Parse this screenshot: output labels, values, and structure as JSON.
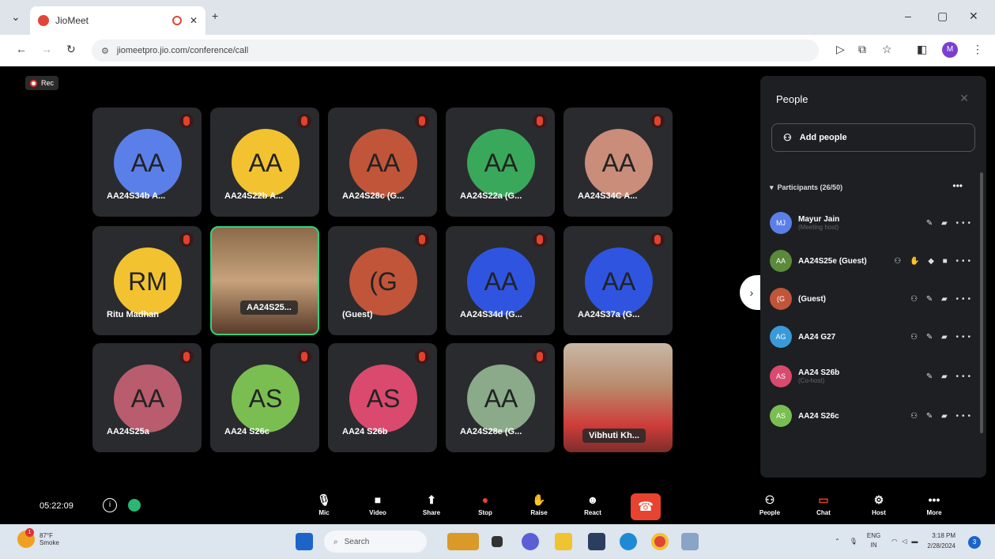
{
  "browser": {
    "tab_title": "JioMeet",
    "url": "jiomeetpro.jio.com/conference/call",
    "profile_initial": "M"
  },
  "meeting": {
    "recording_label": "Rec",
    "timer": "05:22:09",
    "tiles": [
      {
        "initials": "AA",
        "name": "AA24S34b A...",
        "color": "#5b7fe8"
      },
      {
        "initials": "AA",
        "name": "AA24S22b A...",
        "color": "#f2c230"
      },
      {
        "initials": "AA",
        "name": "AA24S28c (G...",
        "color": "#c0553a"
      },
      {
        "initials": "AA",
        "name": "AA24S22a (G...",
        "color": "#3aa85b"
      },
      {
        "initials": "AA",
        "name": "AA24S34C A...",
        "color": "#c98d7a"
      },
      {
        "initials": "RM",
        "name": "Ritu Madhan",
        "color": "#f2c230"
      },
      {
        "initials": "",
        "name": "AA24S25...",
        "color": ""
      },
      {
        "initials": "(G",
        "name": "(Guest)",
        "color": "#c0553a"
      },
      {
        "initials": "AA",
        "name": "AA24S34d (G...",
        "color": "#2f55e0"
      },
      {
        "initials": "AA",
        "name": "AA24S37a (G...",
        "color": "#2f55e0"
      },
      {
        "initials": "AA",
        "name": "AA24S25a",
        "color": "#b85c6e"
      },
      {
        "initials": "AS",
        "name": "AA24 S26c",
        "color": "#7abe52"
      },
      {
        "initials": "AS",
        "name": "AA24 S26b",
        "color": "#d94a6e"
      },
      {
        "initials": "AA",
        "name": "AA24S28e (G...",
        "color": "#8aaa8a"
      },
      {
        "initials": "",
        "name": "Vibhuti Kh...",
        "color": ""
      }
    ]
  },
  "people_panel": {
    "title": "People",
    "add_people": "Add people",
    "participants_header": "Participants (26/50)",
    "participants": [
      {
        "initials": "MJ",
        "name": "Mayur Jain",
        "sub": "(Meeting host)",
        "color": "#5b7fe8"
      },
      {
        "initials": "AA",
        "name": "AA24S25e (Guest)",
        "sub": "",
        "color": "#5a8a3a"
      },
      {
        "initials": "(G",
        "name": "(Guest)",
        "sub": "",
        "color": "#c0553a"
      },
      {
        "initials": "AG",
        "name": "AA24 G27",
        "sub": "",
        "color": "#3a9ad9"
      },
      {
        "initials": "AS",
        "name": "AA24 S26b",
        "sub": "(Co-host)",
        "color": "#d94a6e"
      },
      {
        "initials": "AS",
        "name": "AA24 S26c",
        "sub": "",
        "color": "#7abe52"
      }
    ]
  },
  "toolbar": {
    "mic": "Mic",
    "video": "Video",
    "share": "Share",
    "stop": "Stop",
    "raise": "Raise",
    "react": "React",
    "people": "People",
    "chat": "Chat",
    "host": "Host",
    "more": "More"
  },
  "taskbar": {
    "weather_temp": "87°F",
    "weather_desc": "Smoke",
    "weather_badge": "1",
    "search_placeholder": "Search",
    "lang_top": "ENG",
    "lang_bottom": "IN",
    "time": "3:18 PM",
    "date": "2/28/2024",
    "notification_count": "3"
  }
}
